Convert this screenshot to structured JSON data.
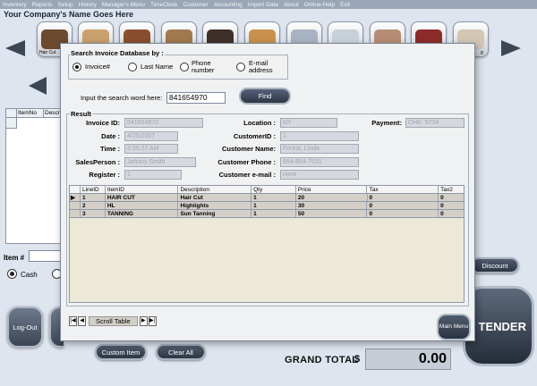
{
  "menu": [
    "Inventory",
    "Reports",
    "Setup",
    "History",
    "Manager's Menu",
    "TimeClock",
    "Customer",
    "Accounting",
    "Import Data",
    "About",
    "Online-Help",
    "Exit"
  ],
  "company_name": "Your Company's Name Goes Here",
  "services_first_label": "Hair Cut",
  "services_last_label": "g",
  "colors": {
    "thumb1": "#6b4a2f",
    "thumb2": "#c9a06e",
    "thumb3": "#8a4e2e",
    "thumb4": "#a07a4e",
    "thumb5": "#3d3028",
    "thumb6": "#c8914e",
    "thumb7": "#a7b3c2",
    "thumb8": "#c8d0d9",
    "thumb9": "#b58d76",
    "thumb10": "#8c2b2b",
    "thumb11": "#d3c6b3"
  },
  "left_grid": {
    "col_itemno": "ItemNo",
    "col_desc": "Description"
  },
  "item_label": "Item #",
  "cash_label": "Cash",
  "buttons": {
    "logout": "Log-Out",
    "custom_item": "Custom Item",
    "clear_all": "Clear All",
    "discount": "Discount",
    "tender": "TENDER",
    "main_menu": "Main Menu"
  },
  "grand_total": {
    "label": "GRAND TOTAL",
    "currency": "$",
    "value": "0.00"
  },
  "dialog": {
    "search_legend": "Search Invoice Database by :",
    "options": [
      "Invoice#",
      "Last Name",
      "Phone number",
      "E-mail address"
    ],
    "selected_option": "Invoice#",
    "search_label": "Input the search word here:",
    "search_value": "841654970",
    "find_label": "Find",
    "result_legend": "Result",
    "fields": {
      "invoice_id": {
        "label": "Invoice ID:",
        "value": "841654970"
      },
      "date": {
        "label": "Date :",
        "value": "4/25/2007"
      },
      "time": {
        "label": "Time :",
        "value": "3:35:27 AM"
      },
      "salesperson": {
        "label": "SalesPerson :",
        "value": "Johnny Smith"
      },
      "register": {
        "label": "Register :",
        "value": "1"
      },
      "location": {
        "label": "Location :",
        "value": "NY"
      },
      "customer_id": {
        "label": "CustomerID :",
        "value": "1"
      },
      "customer_name": {
        "label": "Customer Name:",
        "value": "Forest, Linda"
      },
      "customer_phone": {
        "label": "Customer Phone :",
        "value": "954-854-7531"
      },
      "customer_email": {
        "label": "Customer e-mail :",
        "value": "none"
      },
      "payment": {
        "label": "Payment:",
        "value": "CHK: 5734"
      }
    },
    "table": {
      "columns": [
        "LineID",
        "ItemID",
        "Description",
        "Qty",
        "Price",
        "Tax",
        "Tax2"
      ],
      "rows": [
        [
          "1",
          "HAIR CUT",
          "Hair Cut",
          "1",
          "20",
          "0",
          "0"
        ],
        [
          "2",
          "HL",
          "Highlights",
          "1",
          "30",
          "0",
          "0"
        ],
        [
          "3",
          "TANNING",
          "Sun Tanning",
          "1",
          "50",
          "0",
          "0"
        ]
      ]
    },
    "nav": {
      "label": "Scroll Table"
    }
  }
}
